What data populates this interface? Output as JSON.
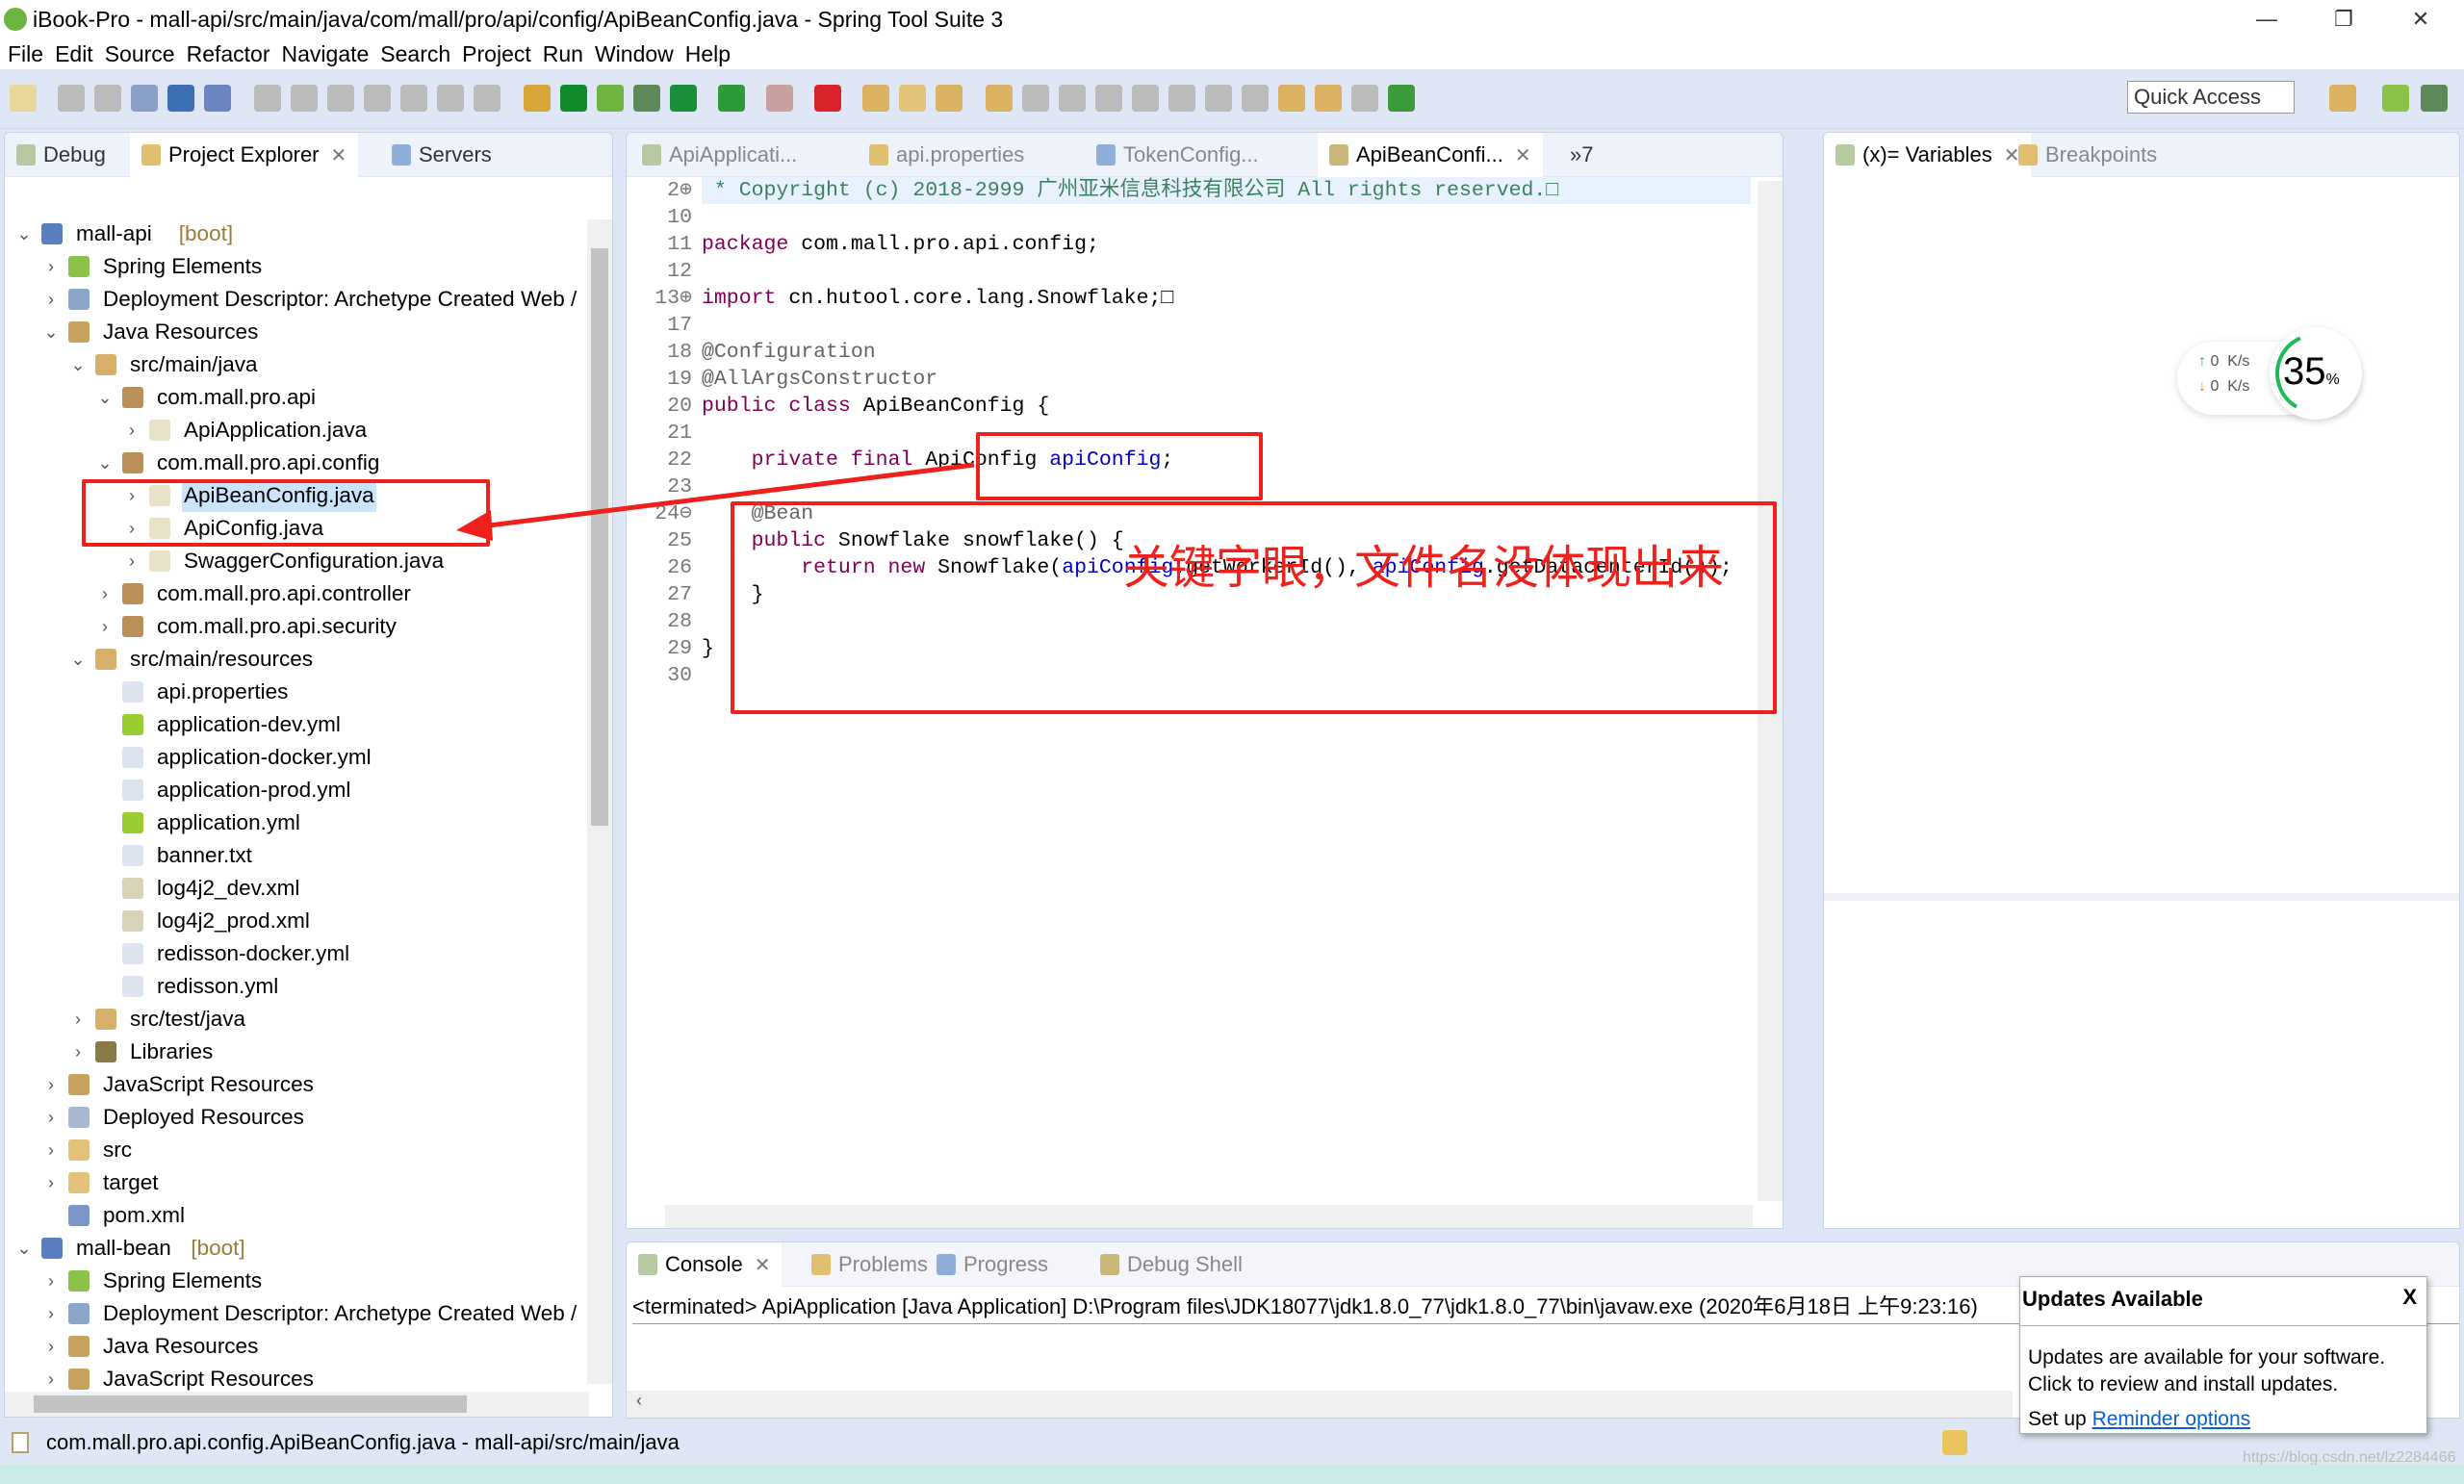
{
  "window": {
    "title": "iBook-Pro - mall-api/src/main/java/com/mall/pro/api/config/ApiBeanConfig.java - Spring Tool Suite 3",
    "minimize": "—",
    "restore": "❐",
    "close": "✕"
  },
  "menu": [
    "File",
    "Edit",
    "Source",
    "Refactor",
    "Navigate",
    "Search",
    "Project",
    "Run",
    "Window",
    "Help"
  ],
  "toolbar": {
    "quick_access_placeholder": "Quick Access"
  },
  "left_panel": {
    "tabs": [
      {
        "label": "Debug"
      },
      {
        "label": "Project Explorer",
        "close": "✕"
      },
      {
        "label": "Servers"
      }
    ],
    "tree": [
      {
        "level": 0,
        "exp": "v",
        "label": "mall-api",
        "suffix": "[boot]",
        "icon": "maven-project-icon"
      },
      {
        "level": 1,
        "exp": ">",
        "label": "Spring Elements",
        "icon": "spring-leaf-icon"
      },
      {
        "level": 1,
        "exp": ">",
        "label": "Deployment Descriptor: Archetype Created Web /",
        "icon": "deployment-descriptor-icon"
      },
      {
        "level": 1,
        "exp": "v",
        "label": "Java Resources",
        "icon": "java-resources-icon"
      },
      {
        "level": 2,
        "exp": "v",
        "label": "src/main/java",
        "icon": "source-folder-icon"
      },
      {
        "level": 3,
        "exp": "v",
        "label": "com.mall.pro.api",
        "icon": "package-icon"
      },
      {
        "level": 4,
        "exp": ">",
        "label": "ApiApplication.java",
        "icon": "java-file-icon"
      },
      {
        "level": 3,
        "exp": "v",
        "label": "com.mall.pro.api.config",
        "icon": "package-icon"
      },
      {
        "level": 4,
        "exp": ">",
        "label": "ApiBeanConfig.java",
        "icon": "java-file-icon",
        "selected": true
      },
      {
        "level": 4,
        "exp": ">",
        "label": "ApiConfig.java",
        "icon": "java-file-icon"
      },
      {
        "level": 4,
        "exp": ">",
        "label": "SwaggerConfiguration.java",
        "icon": "java-file-icon"
      },
      {
        "level": 3,
        "exp": ">",
        "label": "com.mall.pro.api.controller",
        "icon": "package-icon"
      },
      {
        "level": 3,
        "exp": ">",
        "label": "com.mall.pro.api.security",
        "icon": "package-icon"
      },
      {
        "level": 2,
        "exp": "v",
        "label": "src/main/resources",
        "icon": "source-folder-icon"
      },
      {
        "level": 3,
        "exp": "",
        "label": "api.properties",
        "icon": "text-file-icon"
      },
      {
        "level": 3,
        "exp": "",
        "label": "application-dev.yml",
        "icon": "yaml-file-icon"
      },
      {
        "level": 3,
        "exp": "",
        "label": "application-docker.yml",
        "icon": "text-file-icon"
      },
      {
        "level": 3,
        "exp": "",
        "label": "application-prod.yml",
        "icon": "text-file-icon"
      },
      {
        "level": 3,
        "exp": "",
        "label": "application.yml",
        "icon": "yaml-file-icon"
      },
      {
        "level": 3,
        "exp": "",
        "label": "banner.txt",
        "icon": "text-file-icon"
      },
      {
        "level": 3,
        "exp": "",
        "label": "log4j2_dev.xml",
        "icon": "xml-file-icon"
      },
      {
        "level": 3,
        "exp": "",
        "label": "log4j2_prod.xml",
        "icon": "xml-file-icon"
      },
      {
        "level": 3,
        "exp": "",
        "label": "redisson-docker.yml",
        "icon": "text-file-icon"
      },
      {
        "level": 3,
        "exp": "",
        "label": "redisson.yml",
        "icon": "text-file-icon"
      },
      {
        "level": 2,
        "exp": ">",
        "label": "src/test/java",
        "icon": "source-folder-icon"
      },
      {
        "level": 2,
        "exp": ">",
        "label": "Libraries",
        "icon": "libraries-icon"
      },
      {
        "level": 1,
        "exp": ">",
        "label": "JavaScript Resources",
        "icon": "javascript-resources-icon"
      },
      {
        "level": 1,
        "exp": ">",
        "label": "Deployed Resources",
        "icon": "deployed-resources-icon"
      },
      {
        "level": 1,
        "exp": ">",
        "label": "src",
        "icon": "folder-icon"
      },
      {
        "level": 1,
        "exp": ">",
        "label": "target",
        "icon": "folder-icon"
      },
      {
        "level": 1,
        "exp": "",
        "label": "pom.xml",
        "icon": "maven-pom-icon"
      },
      {
        "level": 0,
        "exp": "v",
        "label": "mall-bean",
        "suffix": "[boot]",
        "icon": "maven-project-icon"
      },
      {
        "level": 1,
        "exp": ">",
        "label": "Spring Elements",
        "icon": "spring-leaf-icon"
      },
      {
        "level": 1,
        "exp": ">",
        "label": "Deployment Descriptor: Archetype Created Web /",
        "icon": "deployment-descriptor-icon"
      },
      {
        "level": 1,
        "exp": ">",
        "label": "Java Resources",
        "icon": "java-resources-icon"
      },
      {
        "level": 1,
        "exp": ">",
        "label": "JavaScript Resources",
        "icon": "javascript-resources-icon"
      }
    ]
  },
  "editor": {
    "tabs": [
      {
        "label": "ApiApplicati..."
      },
      {
        "label": "api.properties"
      },
      {
        "label": "TokenConfig..."
      },
      {
        "label": "ApiBeanConfi...",
        "active": true,
        "close": "✕"
      }
    ],
    "overflow": "»7",
    "lines": [
      {
        "n": "2⊕",
        "t": [
          {
            "c": "cm",
            "s": " * Copyright (c) 2018-2999 广州亚米信息科技有限公司 All rights reserved.□"
          }
        ]
      },
      {
        "n": "10",
        "t": []
      },
      {
        "n": "11",
        "t": [
          {
            "c": "kw",
            "s": "package"
          },
          {
            "c": "",
            "s": " com.mall.pro.api.config;"
          }
        ]
      },
      {
        "n": "12",
        "t": []
      },
      {
        "n": "13⊕",
        "t": [
          {
            "c": "kw",
            "s": "import"
          },
          {
            "c": "",
            "s": " cn.hutool.core.lang.Snowflake;□"
          }
        ]
      },
      {
        "n": "17",
        "t": []
      },
      {
        "n": "18",
        "t": [
          {
            "c": "an",
            "s": "@Configuration"
          }
        ]
      },
      {
        "n": "19",
        "t": [
          {
            "c": "an",
            "s": "@AllArgsConstructor"
          }
        ]
      },
      {
        "n": "20",
        "t": [
          {
            "c": "kw",
            "s": "public class"
          },
          {
            "c": "",
            "s": " ApiBeanConfig {"
          }
        ]
      },
      {
        "n": "21",
        "t": []
      },
      {
        "n": "22",
        "t": [
          {
            "c": "",
            "s": "    "
          },
          {
            "c": "kw",
            "s": "private final"
          },
          {
            "c": "",
            "s": " ApiConfig "
          },
          {
            "c": "fld",
            "s": "apiConfig"
          },
          {
            "c": "",
            "s": ";"
          }
        ]
      },
      {
        "n": "23",
        "t": []
      },
      {
        "n": "24⊖",
        "t": [
          {
            "c": "",
            "s": "    "
          },
          {
            "c": "an",
            "s": "@Bean"
          }
        ]
      },
      {
        "n": "25",
        "t": [
          {
            "c": "",
            "s": "    "
          },
          {
            "c": "kw",
            "s": "public"
          },
          {
            "c": "",
            "s": " Snowflake snowflake() {"
          }
        ]
      },
      {
        "n": "26",
        "t": [
          {
            "c": "",
            "s": "        "
          },
          {
            "c": "kw",
            "s": "return new"
          },
          {
            "c": "",
            "s": " Snowflake("
          },
          {
            "c": "fld",
            "s": "apiConfig"
          },
          {
            "c": "",
            "s": ".getWorkerId(), "
          },
          {
            "c": "fld",
            "s": "apiConfig"
          },
          {
            "c": "",
            "s": ".getDatacenterId());"
          }
        ]
      },
      {
        "n": "27",
        "t": [
          {
            "c": "",
            "s": "    }"
          }
        ]
      },
      {
        "n": "28",
        "t": []
      },
      {
        "n": "29",
        "t": [
          {
            "c": "",
            "s": "}"
          }
        ]
      },
      {
        "n": "30",
        "t": []
      }
    ],
    "annotation": "关键字眼，文件名没体现出来"
  },
  "right_panel": {
    "tabs": [
      {
        "label": "(x)= Variables",
        "close": "✕"
      },
      {
        "label": "Breakpoints"
      }
    ]
  },
  "net_widget": {
    "up": "0",
    "down": "0",
    "unit": "K/s",
    "cpu_percent": 35,
    "cpu_label": "35",
    "percent_sign": "%"
  },
  "console": {
    "tabs": [
      {
        "label": "Console",
        "close": "✕"
      },
      {
        "label": "Problems"
      },
      {
        "label": "Progress"
      },
      {
        "label": "Debug Shell"
      }
    ],
    "line": "<terminated> ApiApplication [Java Application] D:\\Program files\\JDK18077\\jdk1.8.0_77\\jdk1.8.0_77\\bin\\javaw.exe (2020年6月18日 上午9:23:16)"
  },
  "popup": {
    "title": "Updates Available",
    "close": "X",
    "body1": "Updates are available for your software.",
    "body2": "Click to review and install updates.",
    "setup": "Set up ",
    "link": "Reminder options"
  },
  "status": {
    "text": "com.mall.pro.api.config.ApiBeanConfig.java - mall-api/src/main/java",
    "watermark": "https://blog.csdn.net/lz2284466"
  },
  "colors": {
    "annotation_red": "#f0201c",
    "selection": "#cce4fb",
    "keyword": "#7f0055",
    "field": "#0000c0",
    "link": "#0b5fd1",
    "cpu_ring": "#1db954"
  }
}
